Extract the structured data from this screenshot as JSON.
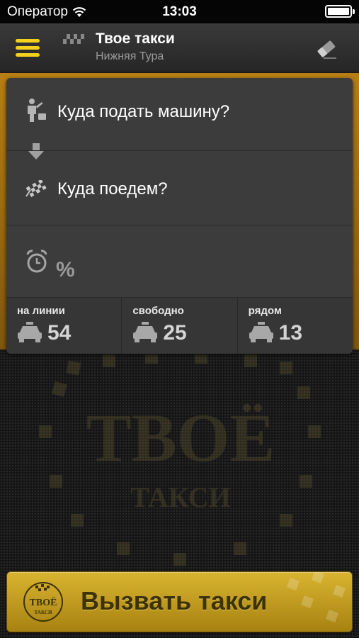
{
  "status_bar": {
    "carrier": "Оператор",
    "time": "13:03"
  },
  "nav": {
    "title": "Твое такси",
    "subtitle": "Нижняя Тура",
    "menu_icon": "menu-icon",
    "eraser_icon": "eraser-icon"
  },
  "order": {
    "from_placeholder": "Куда подать машину?",
    "to_placeholder": "Куда поедем?",
    "time_value": "%"
  },
  "stats": [
    {
      "label": "на линии",
      "value": "54"
    },
    {
      "label": "свободно",
      "value": "25"
    },
    {
      "label": "рядом",
      "value": "13"
    }
  ],
  "watermark": {
    "line1": "ТВОЁ",
    "line2": "ТАКСИ"
  },
  "call_button": {
    "label": "Вызвать такси",
    "logo_line1": "ТВОЁ",
    "logo_line2": "ТАКСИ"
  },
  "colors": {
    "accent": "#f4d21b",
    "button": "#c9a524"
  }
}
